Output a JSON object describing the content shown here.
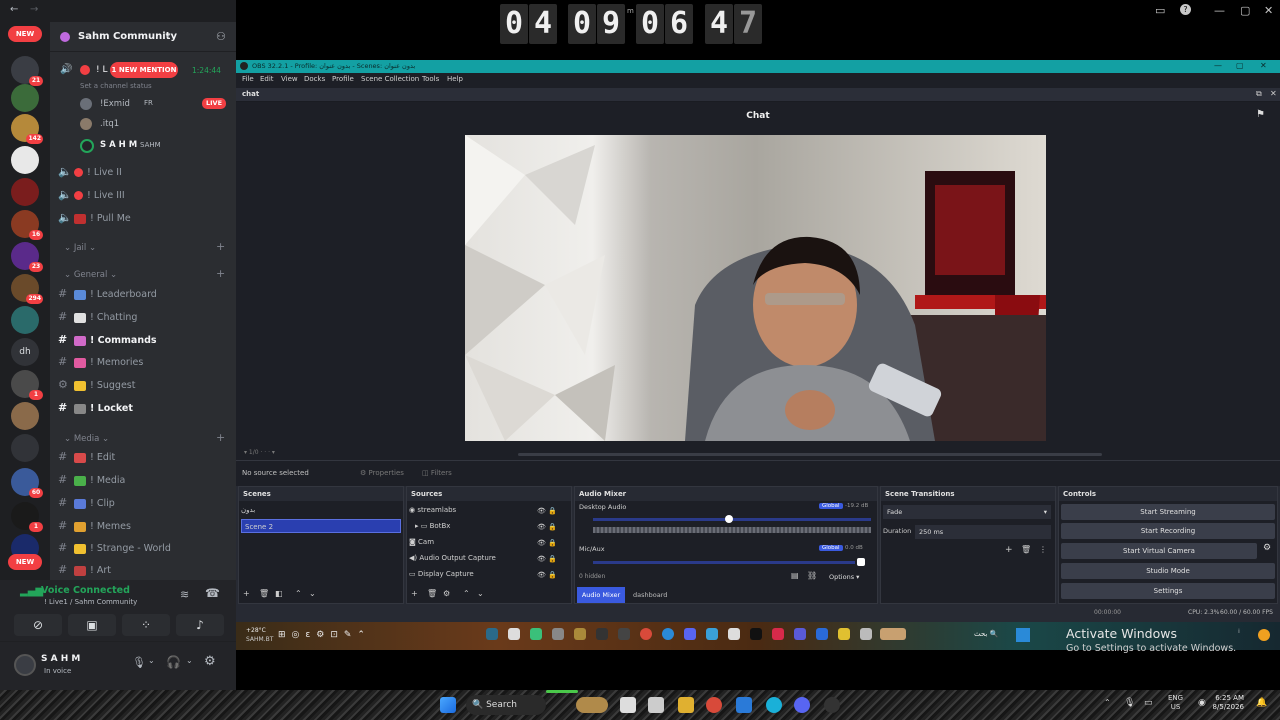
{
  "timer": {
    "d1": "0",
    "d2": "4",
    "d3": "0",
    "d4": "9",
    "d5": "0",
    "d6": "6",
    "d7": "4",
    "d8": "7",
    "sep_label": "m"
  },
  "discord": {
    "new_top": "NEW",
    "server_name": "Sahm Community",
    "mention_pill": "1 NEW MENTION",
    "call_duration": "1:24:44",
    "channel_status": "Set a channel status",
    "voice_members": [
      {
        "name": "!Exmid",
        "tag": "FR",
        "live": "LIVE"
      },
      {
        "name": ".itq1"
      },
      {
        "name": "S A H M",
        "tag": "SAHM"
      }
    ],
    "voice_channels": [
      "! Live II",
      "! Live III",
      "! Pull Me"
    ],
    "categories": {
      "jail": "Jail",
      "general": "General",
      "media": "Media"
    },
    "general_channels": [
      "! Leaderboard",
      "! Chatting",
      "! Commands",
      "! Memories",
      "! Suggest",
      "! Locket"
    ],
    "media_channels": [
      "! Edit",
      "! Media",
      "! Clip",
      "! Memes",
      "! Strange - World",
      "! Art"
    ],
    "badges": [
      "21",
      "142",
      "16",
      "23",
      "294",
      "60",
      "1",
      "1"
    ],
    "server_initials": "dh",
    "new_bottom": "NEW",
    "voice": {
      "status": "Voice Connected",
      "location": "! Live1 / Sahm Community"
    },
    "user": {
      "name": "S A H M",
      "status": "In voice"
    }
  },
  "obs": {
    "title": "OBS 32.2.1 - Profile: بدون عنوان - Scenes: بدون عنوان",
    "menu": [
      "File",
      "Edit",
      "View",
      "Docks",
      "Profile",
      "Scene Collection",
      "Tools",
      "Help"
    ],
    "dock_tab": "chat",
    "chat_title": "Chat",
    "no_source": "No source selected",
    "properties": "Properties",
    "filters": "Filters",
    "panels": {
      "scenes": "Scenes",
      "sources": "Sources",
      "audio": "Audio Mixer",
      "transitions": "Scene Transitions",
      "controls": "Controls"
    },
    "scenes": [
      "بدون",
      "Scene 2"
    ],
    "sources": [
      "streamlabs",
      "BotBx",
      "Cam",
      "Audio Output Capture",
      "Display Capture"
    ],
    "audio": {
      "desktop": "Desktop Audio",
      "mic": "Mic/Aux",
      "global": "Global",
      "db1": "-19.2 dB",
      "db2": "0.0 dB",
      "hidden": "0 hidden",
      "options": "Options",
      "tab1": "Audio Mixer",
      "tab2": "dashboard"
    },
    "transitions": {
      "type": "Fade",
      "duration_label": "Duration",
      "duration_value": "250 ms"
    },
    "controls": [
      "Start Streaming",
      "Start Recording",
      "Start Virtual Camera",
      "Studio Mode",
      "Settings"
    ],
    "status": {
      "time": "00:00:00",
      "cpu": "CPU: 2.3%",
      "fps": "60.00 / 60.00 FPS"
    }
  },
  "inner_taskbar": {
    "temp": "+28°C",
    "sub": "SAHM.BT",
    "search": "بحث"
  },
  "activate": {
    "title": "Activate Windows",
    "sub": "Go to Settings to activate Windows."
  },
  "outer_taskbar": {
    "search": "Search",
    "lang": "ENG",
    "region": "US",
    "time": "6:25 AM",
    "date": "8/5/2026"
  }
}
